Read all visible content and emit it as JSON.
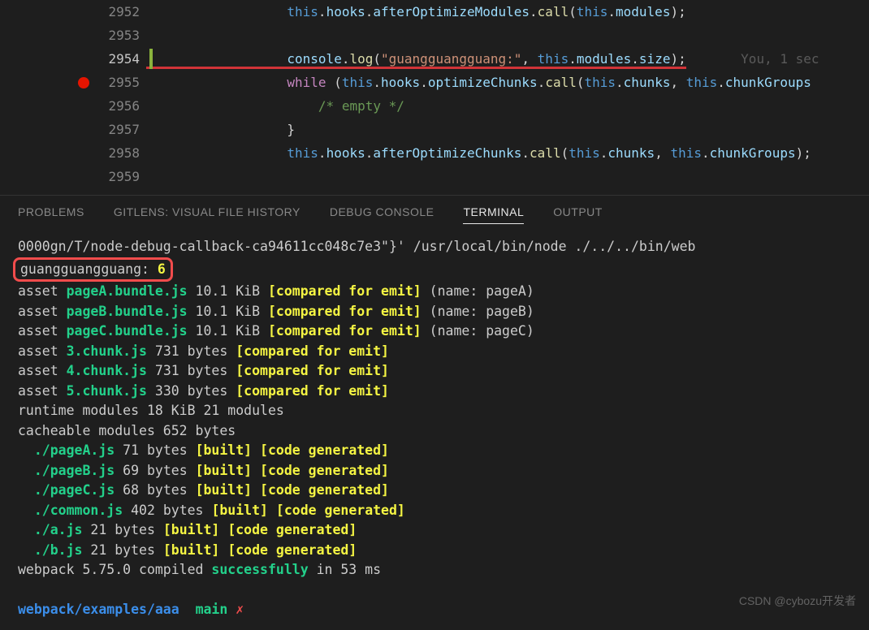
{
  "editor": {
    "lines": [
      {
        "n": "2952",
        "bp": false,
        "cur": false,
        "seg": [
          [
            "",
            "                  "
          ],
          [
            "k-this",
            "this"
          ],
          [
            "k-punc",
            "."
          ],
          [
            "k-prop",
            "hooks"
          ],
          [
            "k-punc",
            "."
          ],
          [
            "k-prop",
            "afterOptimizeModules"
          ],
          [
            "k-punc",
            "."
          ],
          [
            "k-fn",
            "call"
          ],
          [
            "k-paren",
            "("
          ],
          [
            "k-this",
            "this"
          ],
          [
            "k-punc",
            "."
          ],
          [
            "k-prop",
            "modules"
          ],
          [
            "k-paren",
            ")"
          ],
          [
            "k-punc",
            ";"
          ]
        ]
      },
      {
        "n": "2953",
        "bp": false,
        "cur": false,
        "seg": []
      },
      {
        "n": "2954",
        "bp": false,
        "cur": true,
        "under": true,
        "blame": "You, 1 sec",
        "seg": [
          [
            "",
            "                  "
          ],
          [
            "k-prop",
            "console"
          ],
          [
            "k-punc",
            "."
          ],
          [
            "k-fn",
            "log"
          ],
          [
            "k-paren",
            "("
          ],
          [
            "k-str",
            "\"guangguangguang:\""
          ],
          [
            "k-punc",
            ", "
          ],
          [
            "k-this",
            "this"
          ],
          [
            "k-punc",
            "."
          ],
          [
            "k-prop",
            "modules"
          ],
          [
            "k-punc",
            "."
          ],
          [
            "k-prop",
            "size"
          ],
          [
            "k-paren",
            ")"
          ],
          [
            "k-punc",
            ";"
          ]
        ]
      },
      {
        "n": "2955",
        "bp": true,
        "cur": false,
        "seg": [
          [
            "",
            "                  "
          ],
          [
            "k-kw",
            "while"
          ],
          [
            "k-punc",
            " "
          ],
          [
            "k-paren",
            "("
          ],
          [
            "k-this",
            "this"
          ],
          [
            "k-punc",
            "."
          ],
          [
            "k-prop",
            "hooks"
          ],
          [
            "k-punc",
            "."
          ],
          [
            "k-prop",
            "optimizeChunks"
          ],
          [
            "k-punc",
            "."
          ],
          [
            "k-fn",
            "call"
          ],
          [
            "k-paren",
            "("
          ],
          [
            "k-this",
            "this"
          ],
          [
            "k-punc",
            "."
          ],
          [
            "k-prop",
            "chunks"
          ],
          [
            "k-punc",
            ", "
          ],
          [
            "k-this",
            "this"
          ],
          [
            "k-punc",
            "."
          ],
          [
            "k-prop",
            "chunkGroups"
          ]
        ]
      },
      {
        "n": "2956",
        "bp": false,
        "cur": false,
        "seg": [
          [
            "",
            "                      "
          ],
          [
            "k-comment",
            "/* empty */"
          ]
        ]
      },
      {
        "n": "2957",
        "bp": false,
        "cur": false,
        "seg": [
          [
            "",
            "                  "
          ],
          [
            "k-paren",
            "}"
          ]
        ]
      },
      {
        "n": "2958",
        "bp": false,
        "cur": false,
        "seg": [
          [
            "",
            "                  "
          ],
          [
            "k-this",
            "this"
          ],
          [
            "k-punc",
            "."
          ],
          [
            "k-prop",
            "hooks"
          ],
          [
            "k-punc",
            "."
          ],
          [
            "k-prop",
            "afterOptimizeChunks"
          ],
          [
            "k-punc",
            "."
          ],
          [
            "k-fn",
            "call"
          ],
          [
            "k-paren",
            "("
          ],
          [
            "k-this",
            "this"
          ],
          [
            "k-punc",
            "."
          ],
          [
            "k-prop",
            "chunks"
          ],
          [
            "k-punc",
            ", "
          ],
          [
            "k-this",
            "this"
          ],
          [
            "k-punc",
            "."
          ],
          [
            "k-prop",
            "chunkGroups"
          ],
          [
            "k-paren",
            ")"
          ],
          [
            "k-punc",
            ";"
          ]
        ]
      },
      {
        "n": "2959",
        "bp": false,
        "cur": false,
        "seg": []
      }
    ]
  },
  "tabs": {
    "problems": "PROBLEMS",
    "gitlens": "GITLENS: VISUAL FILE HISTORY",
    "debug": "DEBUG CONSOLE",
    "terminal": "TERMINAL",
    "output": "OUTPUT"
  },
  "terminal": {
    "pre": "0000gn/T/node-debug-callback-ca94611cc048c7e3\"}' /usr/local/bin/node ./../../bin/web",
    "hl_label": "guangguangguang: ",
    "hl_value": "6",
    "assets_bundle": [
      {
        "name": "pageA.bundle.js",
        "size": "10.1 KiB",
        "page": "pageA"
      },
      {
        "name": "pageB.bundle.js",
        "size": "10.1 KiB",
        "page": "pageB"
      },
      {
        "name": "pageC.bundle.js",
        "size": "10.1 KiB",
        "page": "pageC"
      }
    ],
    "assets_chunk": [
      {
        "name": "3.chunk.js",
        "size": "731 bytes"
      },
      {
        "name": "4.chunk.js",
        "size": "731 bytes"
      },
      {
        "name": "5.chunk.js",
        "size": "330 bytes"
      }
    ],
    "runtime": "runtime modules 18 KiB 21 modules",
    "cacheable": "cacheable modules 652 bytes",
    "modules": [
      {
        "name": "./pageA.js",
        "size": "71 bytes"
      },
      {
        "name": "./pageB.js",
        "size": "69 bytes"
      },
      {
        "name": "./pageC.js",
        "size": "68 bytes"
      },
      {
        "name": "./common.js",
        "size": "402 bytes"
      },
      {
        "name": "./a.js",
        "size": "21 bytes"
      },
      {
        "name": "./b.js",
        "size": "21 bytes"
      }
    ],
    "compiled_pre": "webpack 5.75.0 compiled ",
    "compiled_status": "successfully",
    "compiled_post": " in 53 ms",
    "prompt_path": "webpack/examples/aaa",
    "prompt_branch": "main",
    "prompt_mark": "✗",
    "cfe": "[compared for emit]",
    "built": "[built]",
    "codegen": "[code generated]",
    "asset": "asset ",
    "name_pre": " (name: ",
    "name_post": ")"
  },
  "watermark": "CSDN @cybozu开发者"
}
